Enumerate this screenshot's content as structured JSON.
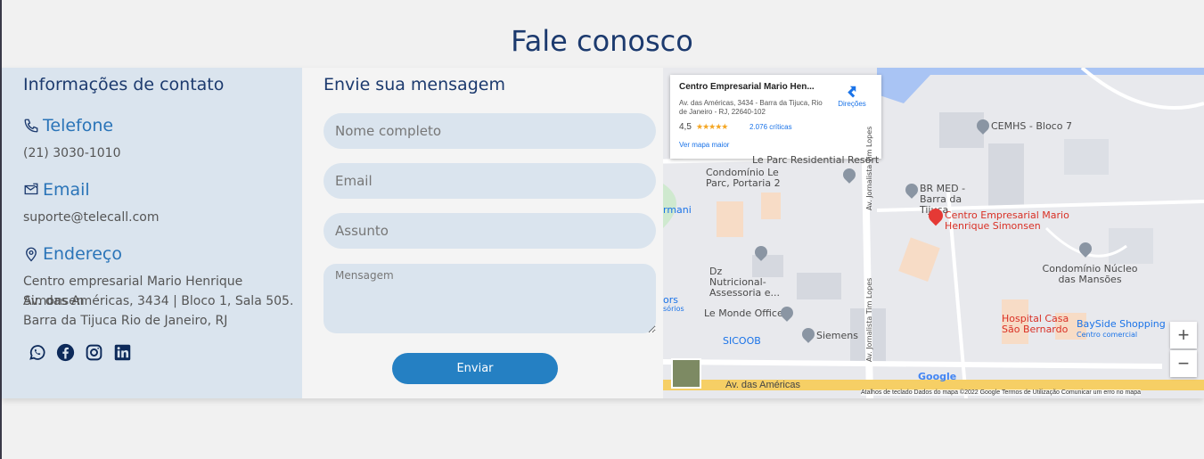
{
  "page": {
    "title": "Fale conosco"
  },
  "contact": {
    "heading": "Informações de contato",
    "phone": {
      "label": "Telefone",
      "value": "(21) 3030-1010"
    },
    "email": {
      "label": "Email",
      "value": "suporte@telecall.com"
    },
    "address": {
      "label": "Endereço",
      "line1": "Centro empresarial Mario Henrique Simonsen",
      "line2": "Av. das Américas, 3434 | Bloco 1, Sala 505.",
      "line3": "Barra da Tijuca Rio de Janeiro, RJ"
    },
    "socials": [
      "whatsapp-icon",
      "facebook-icon",
      "instagram-icon",
      "linkedin-icon"
    ]
  },
  "form": {
    "heading": "Envie sua mensagem",
    "name_placeholder": "Nome completo",
    "email_placeholder": "Email",
    "subject_placeholder": "Assunto",
    "message_placeholder": "Mensagem",
    "submit_label": "Enviar"
  },
  "map": {
    "card": {
      "title": "Centro Empresarial Mario Hen...",
      "address": "Av. das Américas, 3434 - Barra da Tijuca, Rio de Janeiro - RJ, 22640-102",
      "rating": "4,5",
      "stars": "★★★★★",
      "reviews": "2.076 críticas",
      "larger_map": "Ver mapa maior",
      "directions": "Direções"
    },
    "labels": {
      "cemhs": "CEMHS - Bloco 7",
      "leparc": "Le Parc Residential Resort",
      "condominio_leparc": "Condomínio Le Parc, Portaria 2",
      "brmed": "BR MED - Barra da Tijuca",
      "target": "Centro Empresarial Mario Henrique Simonsen",
      "armani": "rmani",
      "dz": "Dz Nutricional- Assessoria e...",
      "condominio_nucleo": "Condomínio Núcleo das Mansões",
      "lemonde": "Le Monde Office",
      "ors": "ors",
      "sorios": "sórios",
      "hospital": "Hospital Casa São Bernardo",
      "bayside": "BaySide Shopping",
      "bayside_sub": "Centro comercial",
      "sicoob": "SICOOB",
      "siemens": "Siemens",
      "street_tim": "Av. Jornalista Tim Lopes",
      "street_americas": "Av. das Américas",
      "google": "Google"
    },
    "zoom_in": "+",
    "zoom_out": "−",
    "attribution": "Atalhos de teclado   Dados do mapa ©2022 Google   Termos de Utilização   Comunicar um erro no mapa"
  }
}
